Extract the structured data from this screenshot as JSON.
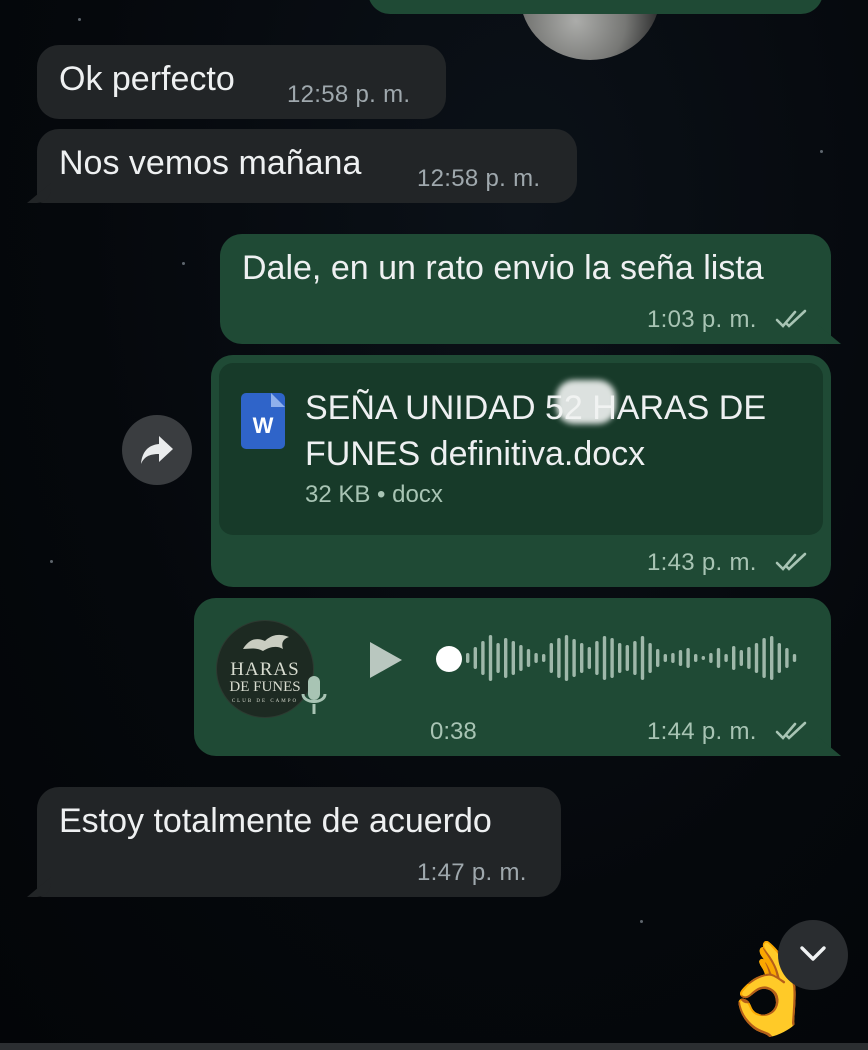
{
  "messages": [
    {
      "text": "Ok perfecto",
      "time": "12:58 p. m."
    },
    {
      "text": "Nos vemos mañana",
      "time": "12:58 p. m."
    },
    {
      "text": "Dale, en un rato envio la seña lista",
      "time": "1:03 p. m."
    },
    {
      "doc_title": "SEÑA UNIDAD 52 HARAS DE FUNES definitiva.docx",
      "doc_meta": "32 KB • docx",
      "doc_icon_letter": "W",
      "time": "1:43 p. m."
    },
    {
      "duration": "0:38",
      "time": "1:44 p. m.",
      "avatar_line1": "HARAS",
      "avatar_line2": "DE FUNES",
      "avatar_line3": "CLUB DE CAMPO"
    },
    {
      "text": "Estoy totalmente de acuerdo",
      "time": "1:47 p. m."
    }
  ],
  "icons": {
    "forward": "forward-arrow-icon",
    "read_receipt": "double-check-icon",
    "play": "play-icon",
    "mic": "microphone-icon",
    "scroll_down": "chevron-down-icon",
    "emoji": "👌"
  },
  "colors": {
    "incoming_bubble": "#222527",
    "outgoing_bubble": "#1f4a35",
    "document_card": "#173a29",
    "word_blue": "#2f64c9"
  }
}
